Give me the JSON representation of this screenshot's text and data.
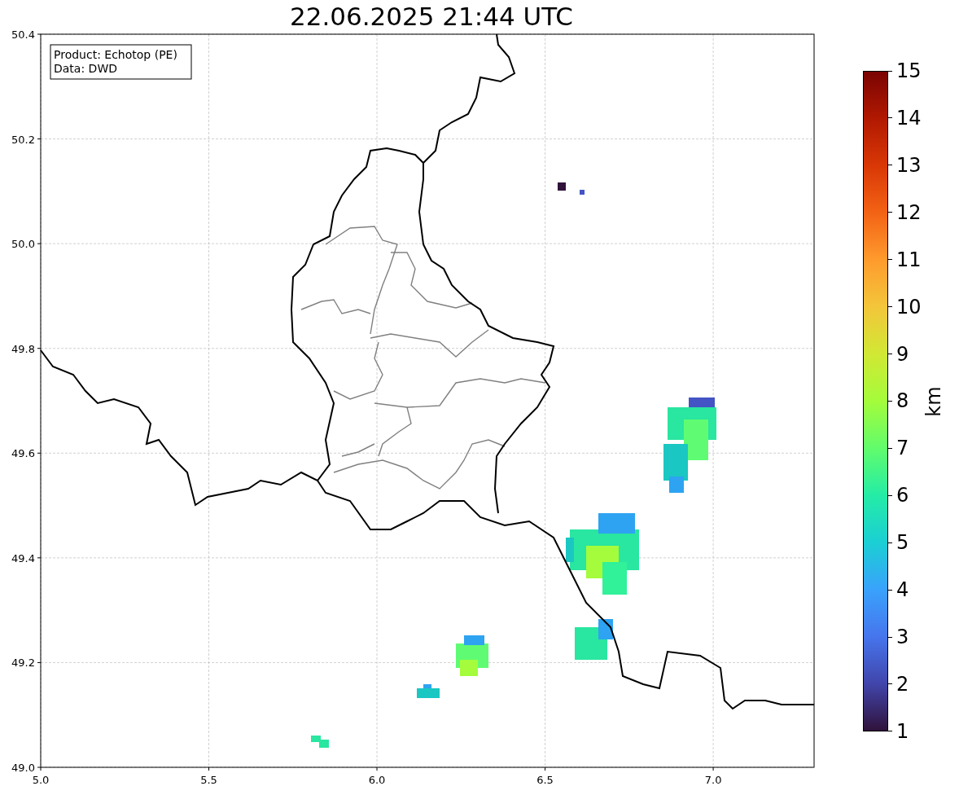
{
  "title": "22.06.2025 21:44 UTC",
  "map": {
    "info_box": [
      "Product: Echotop (PE)",
      "Data: DWD"
    ],
    "x_ticks": [
      "5.0",
      "5.5",
      "6.0",
      "6.5",
      "7.0"
    ],
    "y_ticks": [
      "50.4",
      "50.2",
      "50.0",
      "49.8",
      "49.6",
      "49.4",
      "49.2",
      "49.0"
    ]
  },
  "colorbar": {
    "label": "km",
    "ticks": [
      "15",
      "14",
      "13",
      "12",
      "11",
      "10",
      "9",
      "8",
      "7",
      "6",
      "5",
      "4",
      "3",
      "2",
      "1"
    ]
  }
}
